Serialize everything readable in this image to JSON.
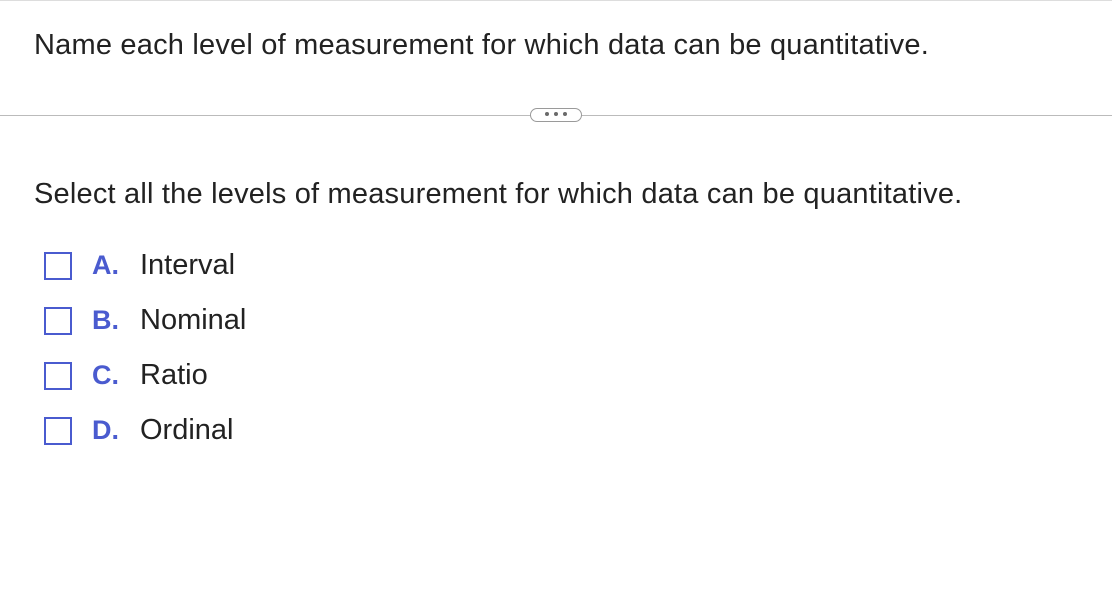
{
  "question": "Name each level of measurement for which data can be quantitative.",
  "instruction": "Select all the levels of measurement for which data can be quantitative.",
  "options": [
    {
      "letter": "A.",
      "text": "Interval"
    },
    {
      "letter": "B.",
      "text": "Nominal"
    },
    {
      "letter": "C.",
      "text": "Ratio"
    },
    {
      "letter": "D.",
      "text": "Ordinal"
    }
  ]
}
